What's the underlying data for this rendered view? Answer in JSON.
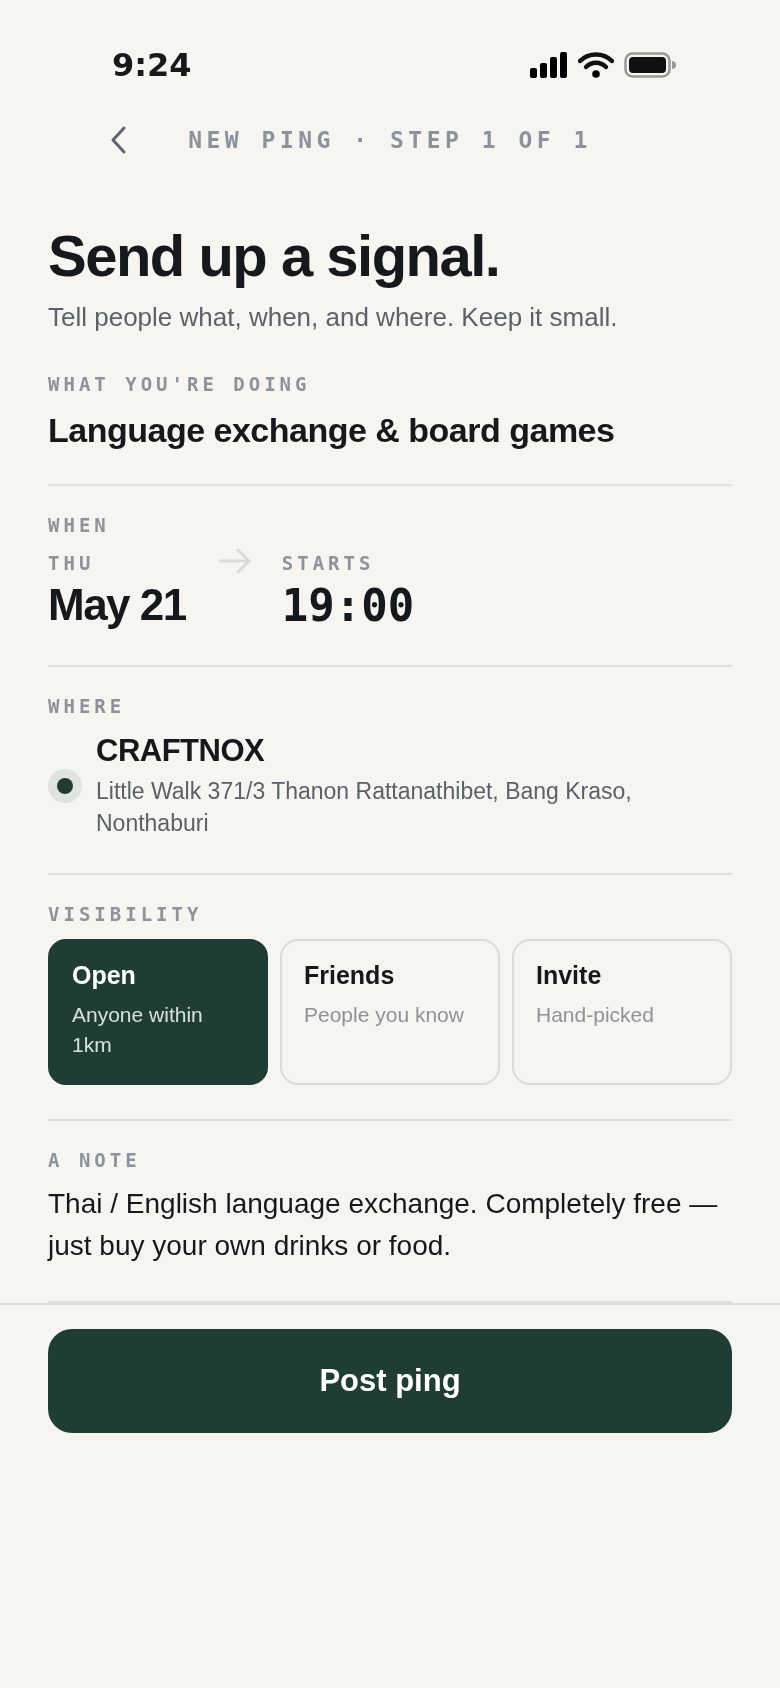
{
  "status_bar": {
    "time": "9:24"
  },
  "header": {
    "title": "NEW PING · STEP 1 OF 1"
  },
  "heading": "Send up a signal.",
  "subtitle": "Tell people what, when, and where. Keep it small.",
  "what": {
    "label": "WHAT YOU'RE DOING",
    "value": "Language exchange & board games"
  },
  "when": {
    "label": "WHEN",
    "day": "THU",
    "date": "May 21",
    "starts_label": "STARTS",
    "time": "19:00"
  },
  "where": {
    "label": "WHERE",
    "name": "CRAFTNOX",
    "address": "Little Walk 371/3 Thanon Rattanathibet, Bang Kraso, Nonthaburi"
  },
  "visibility": {
    "label": "VISIBILITY",
    "options": [
      {
        "title": "Open",
        "description": "Anyone within 1km",
        "selected": true
      },
      {
        "title": "Friends",
        "description": "People you know",
        "selected": false
      },
      {
        "title": "Invite",
        "description": "Hand-picked",
        "selected": false
      }
    ]
  },
  "note": {
    "label": "A NOTE",
    "text": "Thai / English language exchange. Completely free — just buy your own drinks or food."
  },
  "primary_button": "Post ping"
}
